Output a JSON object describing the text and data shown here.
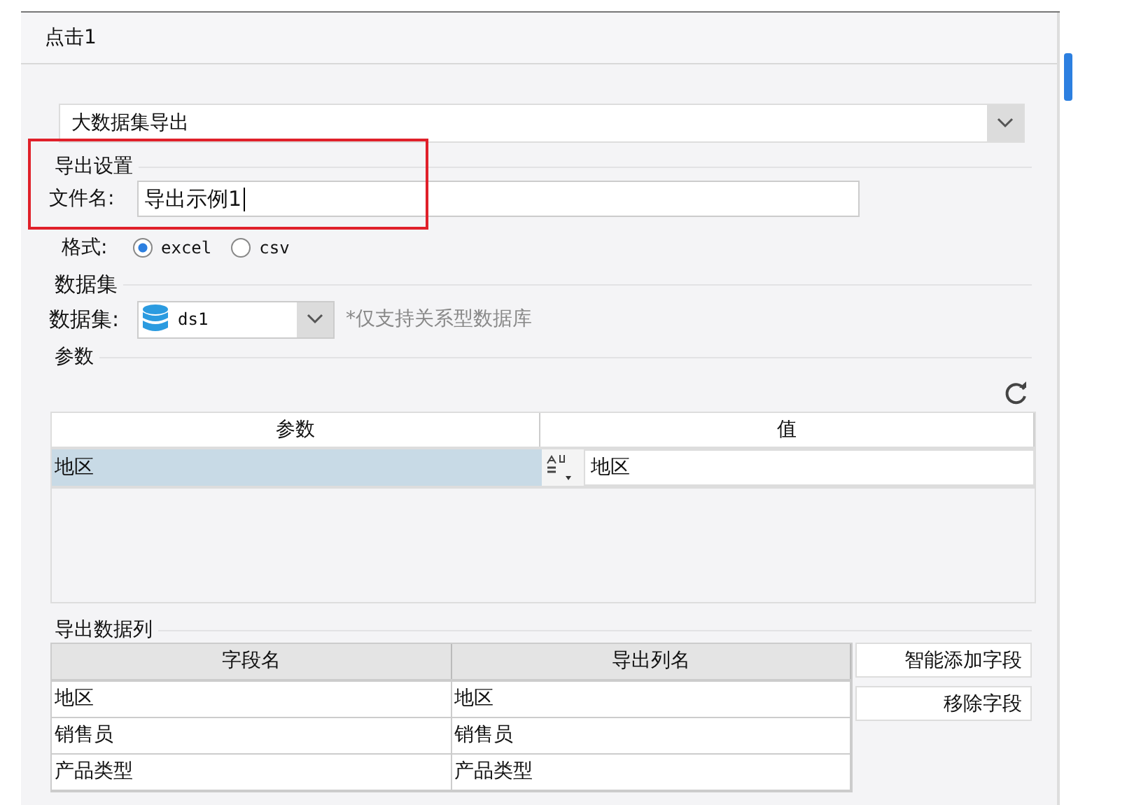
{
  "panel": {
    "title": "点击1"
  },
  "export_type": {
    "value": "大数据集导出"
  },
  "export_settings": {
    "heading": "导出设置",
    "file_name": {
      "label": "文件名:",
      "value": "导出示例1"
    },
    "highlighted": true,
    "format": {
      "label": "格式:",
      "options": [
        {
          "label": "excel",
          "selected": true
        },
        {
          "label": "csv",
          "selected": false
        }
      ]
    }
  },
  "dataset_section": {
    "heading": "数据集",
    "label": "数据集:",
    "value": "ds1",
    "note": "*仅支持关系型数据库"
  },
  "params": {
    "heading": "参数",
    "columns": [
      "参数",
      "值"
    ],
    "rows": [
      {
        "name": "地区",
        "value": "地区",
        "selected": true
      }
    ]
  },
  "export_columns": {
    "heading": "导出数据列",
    "columns": [
      "字段名",
      "导出列名"
    ],
    "rows": [
      {
        "field": "地区",
        "export_name": "地区"
      },
      {
        "field": "销售员",
        "export_name": "销售员"
      },
      {
        "field": "产品类型",
        "export_name": "产品类型"
      }
    ],
    "buttons": [
      "智能添加字段",
      "移除字段"
    ]
  }
}
